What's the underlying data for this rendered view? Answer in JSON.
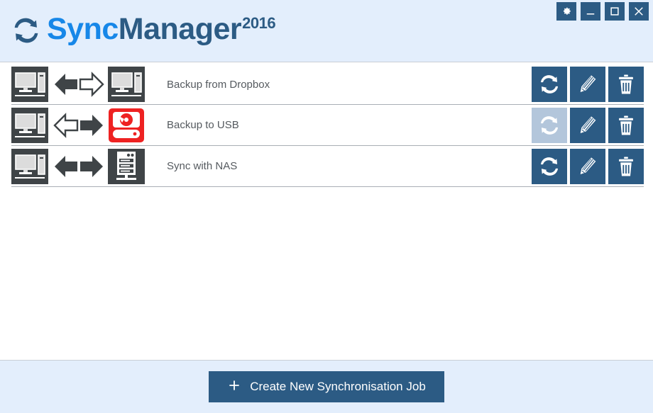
{
  "window": {
    "titlebar_buttons": [
      {
        "name": "settings",
        "label": "Settings",
        "icon": "gear-icon"
      },
      {
        "name": "minimize",
        "label": "Minimize",
        "icon": "minimize-icon"
      },
      {
        "name": "maximize",
        "label": "Maximize",
        "icon": "maximize-icon"
      },
      {
        "name": "close",
        "label": "Close",
        "icon": "close-icon"
      }
    ]
  },
  "brand": {
    "logo_icon": "sync-arrows-icon",
    "name_part1": "Sync",
    "name_part2": "Manager",
    "year": "2016"
  },
  "colors": {
    "accent_blue": "#2c5b84",
    "bright_blue": "#1787e8",
    "header_bg": "#e3eefc",
    "disabled_blue": "#b3c6db",
    "device_gray": "#3f4447",
    "alert_red": "#ee2222",
    "row_divider": "#a9aeb5",
    "label_text": "#555a5f"
  },
  "jobs": [
    {
      "label": "Backup from Dropbox",
      "source_icon": "computer-icon",
      "target_icon": "computer-icon",
      "direction_icon": "arrow-left-filled-right-outline-icon",
      "direction": "left-filled-right-outline",
      "target_alert": false,
      "actions": [
        {
          "name": "sync",
          "icon": "sync-arrows-icon",
          "enabled": true
        },
        {
          "name": "edit",
          "icon": "pencil-icon",
          "enabled": true
        },
        {
          "name": "delete",
          "icon": "trash-icon",
          "enabled": true
        }
      ]
    },
    {
      "label": "Backup to USB",
      "source_icon": "computer-icon",
      "target_icon": "external-drive-icon",
      "direction_icon": "arrow-left-outline-right-filled-icon",
      "direction": "left-outline-right-filled",
      "target_alert": true,
      "actions": [
        {
          "name": "sync",
          "icon": "sync-arrows-icon",
          "enabled": false
        },
        {
          "name": "edit",
          "icon": "pencil-icon",
          "enabled": true
        },
        {
          "name": "delete",
          "icon": "trash-icon",
          "enabled": true
        }
      ]
    },
    {
      "label": "Sync with NAS",
      "source_icon": "computer-icon",
      "target_icon": "nas-icon",
      "direction_icon": "arrow-both-filled-icon",
      "direction": "both-filled",
      "target_alert": false,
      "actions": [
        {
          "name": "sync",
          "icon": "sync-arrows-icon",
          "enabled": true
        },
        {
          "name": "edit",
          "icon": "pencil-icon",
          "enabled": true
        },
        {
          "name": "delete",
          "icon": "trash-icon",
          "enabled": true
        }
      ]
    }
  ],
  "footer": {
    "create_button_label": "Create New Synchronisation Job",
    "create_button_icon": "plus-icon"
  }
}
